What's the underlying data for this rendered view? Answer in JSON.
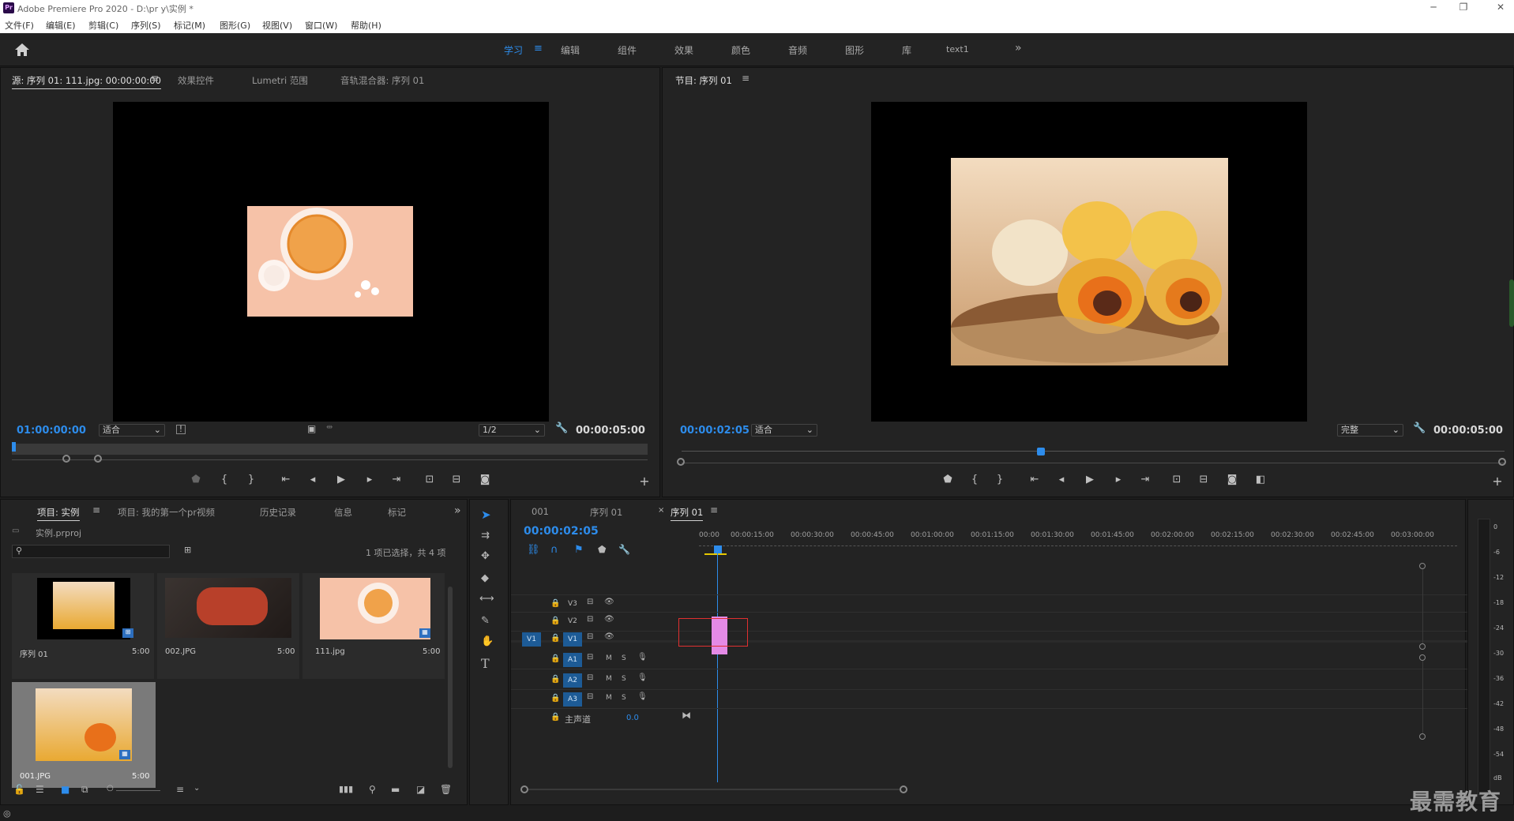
{
  "app": {
    "title": "Adobe Premiere Pro 2020 - D:\\pr y\\实例 *",
    "logo": "Pr"
  },
  "menu": [
    "文件(F)",
    "编辑(E)",
    "剪辑(C)",
    "序列(S)",
    "标记(M)",
    "图形(G)",
    "视图(V)",
    "窗口(W)",
    "帮助(H)"
  ],
  "workspaces": [
    "学习",
    "编辑",
    "组件",
    "效果",
    "颜色",
    "音频",
    "图形",
    "库",
    "text1"
  ],
  "workspace_active": "学习",
  "source": {
    "tabs": [
      "源: 序列 01: 111.jpg: 00:00:00:00",
      "效果控件",
      "Lumetri 范围",
      "音轨混合器: 序列 01"
    ],
    "timecode": "01:00:00:00",
    "fit": "适合",
    "resolution": "1/2",
    "duration": "00:00:05:00"
  },
  "program": {
    "tab": "节目: 序列 01",
    "timecode": "00:00:02:05",
    "fit": "适合",
    "quality": "完整",
    "duration": "00:00:05:00"
  },
  "project": {
    "tabs": [
      "项目: 实例",
      "项目: 我的第一个pr视频",
      "历史记录",
      "信息",
      "标记"
    ],
    "file": "实例.prproj",
    "selection_info": "1 项已选择，共 4 项",
    "items": [
      {
        "name": "序列 01",
        "duration": "5:00"
      },
      {
        "name": "002.JPG",
        "duration": "5:00"
      },
      {
        "name": "111.jpg",
        "duration": "5:00"
      },
      {
        "name": "001.JPG",
        "duration": "5:00"
      }
    ]
  },
  "timeline": {
    "tabs": [
      "001",
      "序列 01",
      "序列 01"
    ],
    "timecode": "00:00:02:05",
    "ruler": [
      "00:00",
      "00:00:15:00",
      "00:00:30:00",
      "00:00:45:00",
      "00:01:00:00",
      "00:01:15:00",
      "00:01:30:00",
      "00:01:45:00",
      "00:02:00:00",
      "00:02:15:00",
      "00:02:30:00",
      "00:02:45:00",
      "00:03:00:00"
    ],
    "video_tracks": [
      "V3",
      "V2",
      "V1"
    ],
    "audio_tracks": [
      "A1",
      "A2",
      "A3"
    ],
    "source_patch": "V1",
    "master_label": "主声道",
    "master_value": "0.0",
    "m_label": "M",
    "s_label": "S"
  },
  "meter": [
    "0",
    "-6",
    "-12",
    "-18",
    "-24",
    "-30",
    "-36",
    "-42",
    "-48",
    "-54",
    "dB"
  ],
  "watermark": "最需教育"
}
